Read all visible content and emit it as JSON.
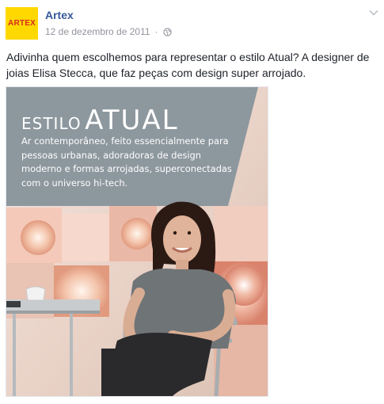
{
  "page": {
    "author": "Artex",
    "avatar_text": "ARTEX",
    "date": "12 de dezembro de 2011",
    "separator": "·"
  },
  "post": {
    "text": "Adivinha quem escolhemos para representar o estilo Atual? A designer de joias Elisa Stecca, que faz peças com design super arrojado."
  },
  "photo": {
    "banner_title_small": "ESTILO",
    "banner_title_large": "ATUAL",
    "banner_body": "Ar contemporâneo, feito essencialmente para pessoas urbanas, adoradoras de design moderno e formas arrojadas, superconectadas com o universo hi-tech."
  },
  "colors": {
    "link": "#365899",
    "meta": "#90949c",
    "text": "#1d2129",
    "banner": "#8d979e",
    "logo_bg": "#ffd800",
    "logo_text": "#d62b1f"
  },
  "icons": {
    "audience": "globe-icon",
    "menu": "chevron-down-icon"
  }
}
